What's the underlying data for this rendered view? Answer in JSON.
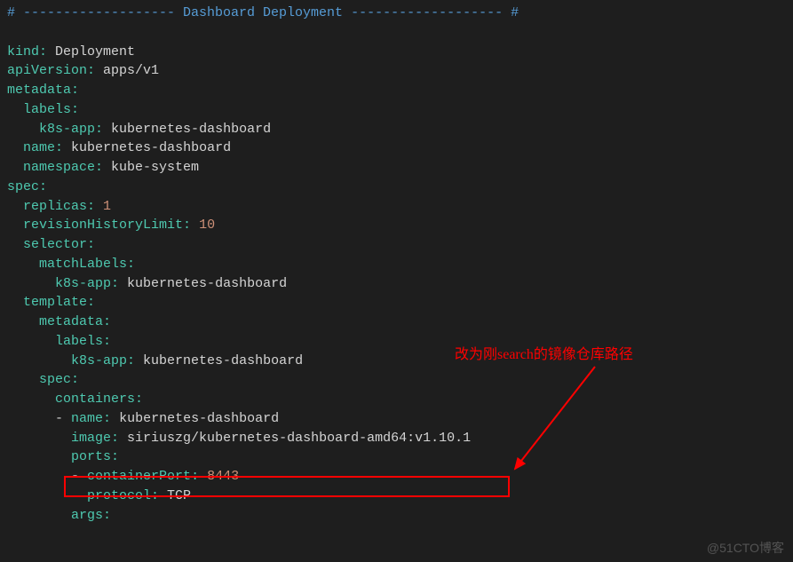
{
  "comment_line": "# ------------------- Dashboard Deployment ------------------- #",
  "yaml": {
    "kind_key": "kind",
    "kind_val": "Deployment",
    "apiv_key": "apiVersion",
    "apiv_val": "apps/v1",
    "meta_key": "metadata",
    "labels_key": "labels",
    "k8sapp_key": "k8s-app",
    "k8sapp_val": "kubernetes-dashboard",
    "name_key": "name",
    "name_val": "kubernetes-dashboard",
    "ns_key": "namespace",
    "ns_val": "kube-system",
    "spec_key": "spec",
    "replicas_key": "replicas",
    "replicas_val": "1",
    "rhl_key": "revisionHistoryLimit",
    "rhl_val": "10",
    "selector_key": "selector",
    "matchlabels_key": "matchLabels",
    "template_key": "template",
    "containers_key": "containers",
    "cname_key": "name",
    "cname_val": "kubernetes-dashboard",
    "image_key": "image",
    "image_val": "siriuszg/kubernetes-dashboard-amd64:v1.10.1",
    "ports_key": "ports",
    "cport_key": "containerPort",
    "cport_val": "8443",
    "proto_key": "protocol",
    "proto_val": "TCP",
    "args_key": "args"
  },
  "annotation_text": "改为刚search的镜像仓库路径",
  "watermark": "@51CTO博客"
}
